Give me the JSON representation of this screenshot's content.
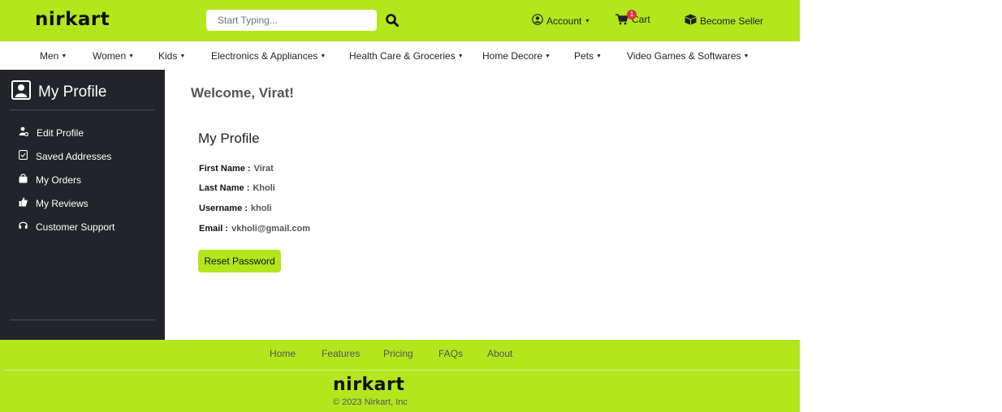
{
  "brand": {
    "logo_text": "nirkart",
    "accent_color": "#b4e61e",
    "sidebar_color": "#212529"
  },
  "header": {
    "search": {
      "placeholder": "Start Typing..."
    },
    "account_label": "Account",
    "cart_label": "Cart",
    "cart_count": "1",
    "seller_label": "Become Seller"
  },
  "categories": [
    "Men",
    "Women",
    "Kids",
    "Electronics & Appliances",
    "Health Care & Groceries",
    "Home Decore",
    "Pets",
    "Video Games & Softwares"
  ],
  "sidebar": {
    "title": "My Profile",
    "items": [
      {
        "label": "Edit Profile",
        "icon": "user-edit-icon"
      },
      {
        "label": "Saved Addresses",
        "icon": "address-book-icon"
      },
      {
        "label": "My Orders",
        "icon": "shopping-bag-icon"
      },
      {
        "label": "My Reviews",
        "icon": "thumbs-up-icon"
      },
      {
        "label": "Customer Support",
        "icon": "headset-icon"
      }
    ]
  },
  "main": {
    "welcome": "Welcome, Virat!",
    "card_title": "My Profile",
    "fields": [
      {
        "label": "First Name :",
        "value": "Virat"
      },
      {
        "label": "Last Name :",
        "value": "Kholi"
      },
      {
        "label": "Username :",
        "value": "kholi"
      },
      {
        "label": "Email :",
        "value": "vkholi@gmail.com"
      }
    ],
    "reset_button": "Reset Password"
  },
  "footer": {
    "links": [
      "Home",
      "Features",
      "Pricing",
      "FAQs",
      "About"
    ],
    "copyright": "© 2023 Nirkart, Inc"
  }
}
